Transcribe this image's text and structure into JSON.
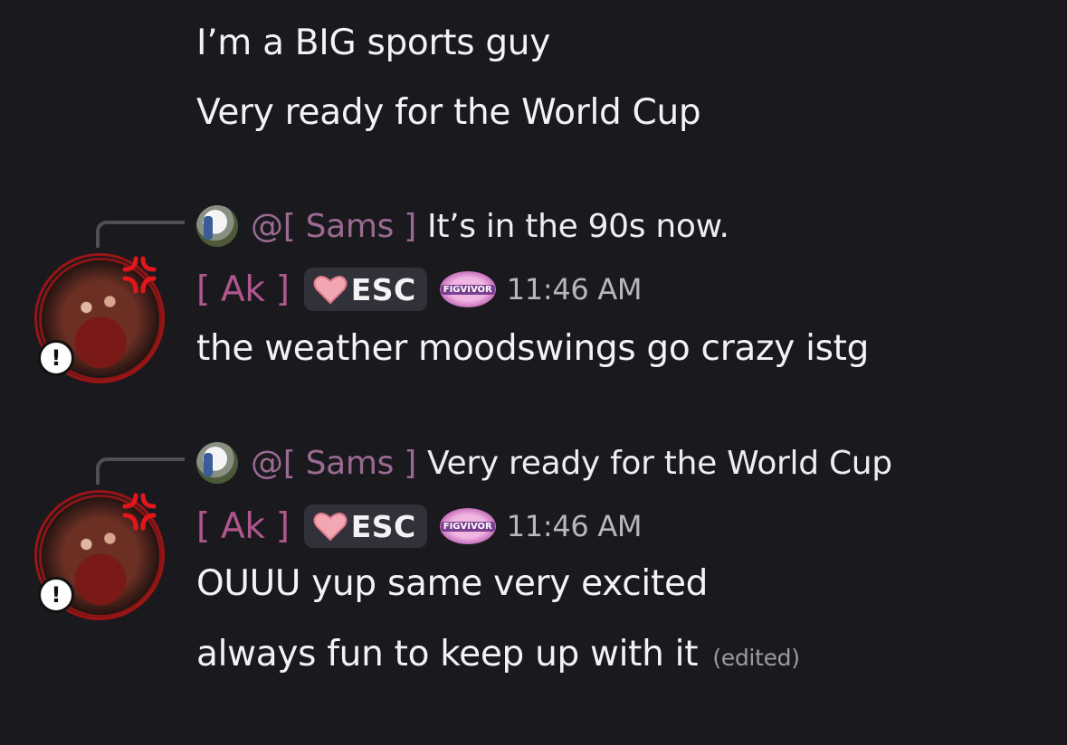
{
  "colors": {
    "background": "#1a1a1e",
    "author": "#b0568f",
    "mention": "#9b6a93",
    "timestamp": "#b5b8bf",
    "message_text": "#f2f3f5"
  },
  "prior_messages": [
    {
      "text": "I’m a BIG sports guy"
    },
    {
      "text": "Very ready for the World Cup"
    }
  ],
  "groups": [
    {
      "reply": {
        "mention": "@[ Sams ]",
        "text": "It’s in the 90s now."
      },
      "author": "[ Ak ]",
      "tag": "ESC",
      "badge": "FIGVIVOR",
      "time": "11:46 AM",
      "messages": [
        {
          "text": "the weather moodswings go crazy istg"
        }
      ]
    },
    {
      "reply": {
        "mention": "@[ Sams ]",
        "text": "Very ready for the World Cup"
      },
      "author": "[ Ak ]",
      "tag": "ESC",
      "badge": "FIGVIVOR",
      "time": "11:46 AM",
      "messages": [
        {
          "text": "OUUU yup same very excited"
        },
        {
          "text": "always fun to keep up with it",
          "edited": "(edited)"
        }
      ]
    }
  ],
  "icons": {
    "reply_avatar": "user-avatar-icon",
    "author_avatar": "user-avatar-icon",
    "status_decoration": "anger-icon",
    "alert": "exclamation-icon",
    "tag_icon": "heart-icon"
  }
}
